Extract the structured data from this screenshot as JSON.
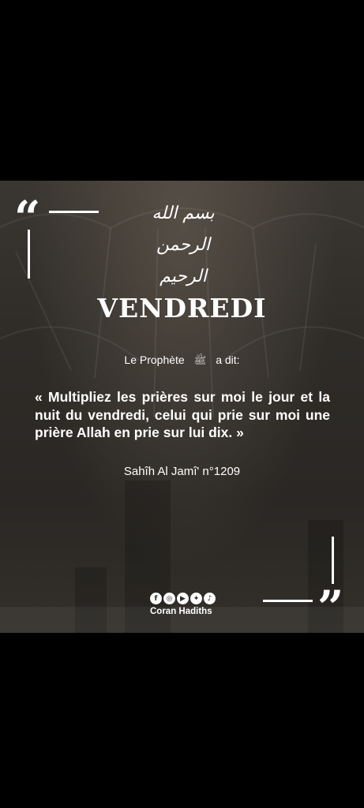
{
  "post": {
    "basmala": "بسم الله الرحمن الرحيم",
    "title": "VENDREDI",
    "intro_before": "Le Prophète",
    "saw_symbol": "ﷺ",
    "intro_after": "a dit:",
    "hadith": "« Multipliez les prières sur moi le jour et la nuit du vendredi, celui qui prie sur moi une prière Allah en prie sur lui dix. »",
    "source": "Sahîh Al Jamî' n°1209",
    "open_quote": "“",
    "close_quote": "”"
  },
  "brand": {
    "name": "Coran Hadiths",
    "social_icons": [
      {
        "name": "facebook-icon",
        "glyph": "f"
      },
      {
        "name": "instagram-icon",
        "glyph": "◎"
      },
      {
        "name": "youtube-icon",
        "glyph": "▶"
      },
      {
        "name": "twitter-icon",
        "glyph": "✦"
      },
      {
        "name": "tiktok-icon",
        "glyph": "♪"
      }
    ]
  },
  "colors": {
    "background": "#000000",
    "card": "#2f2c28",
    "text": "#ffffff"
  }
}
